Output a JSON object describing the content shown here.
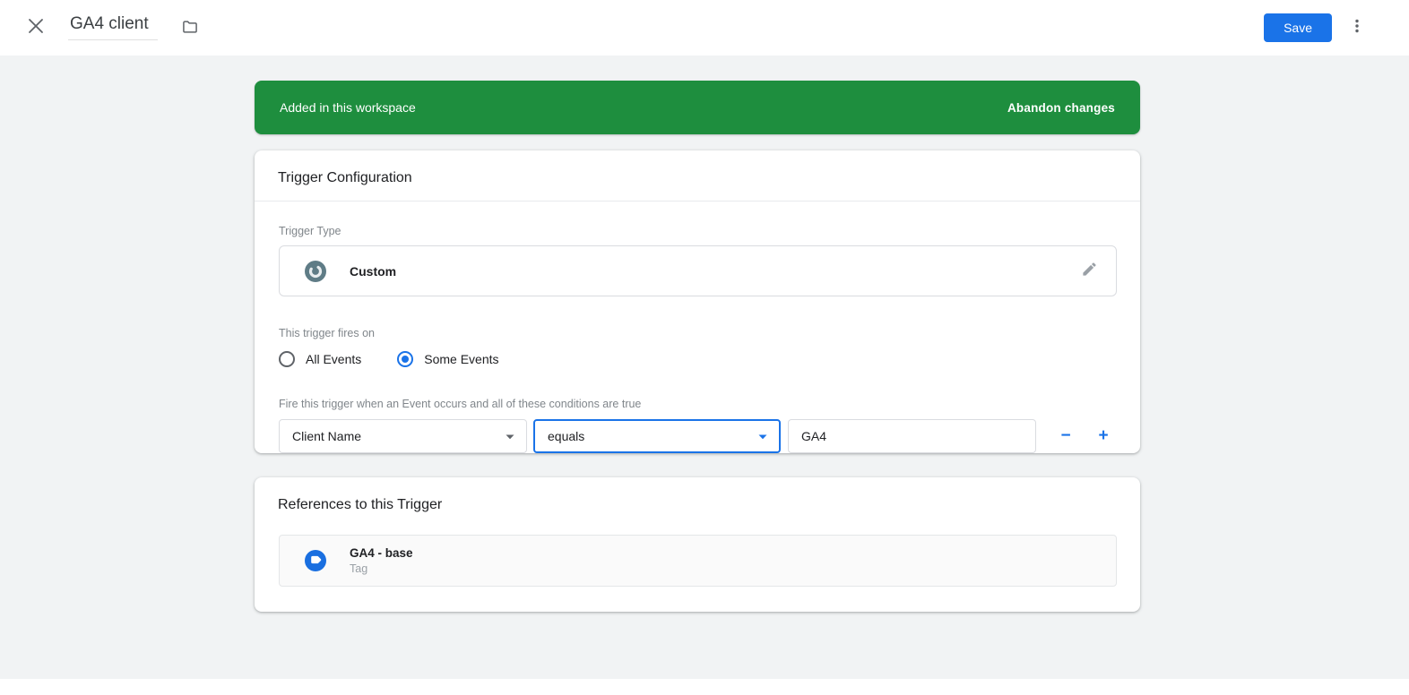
{
  "header": {
    "title": "GA4 client",
    "save_label": "Save"
  },
  "banner": {
    "message": "Added in this workspace",
    "action_label": "Abandon changes"
  },
  "trigger_card": {
    "title": "Trigger Configuration",
    "trigger_type_label": "Trigger Type",
    "trigger_type_value": "Custom",
    "fires_on_label": "This trigger fires on",
    "fire_options": [
      {
        "label": "All Events",
        "selected": false
      },
      {
        "label": "Some Events",
        "selected": true
      }
    ],
    "conditions_label": "Fire this trigger when an Event occurs and all of these conditions are true",
    "condition": {
      "variable": "Client Name",
      "operator": "equals",
      "value": "GA4"
    }
  },
  "references_card": {
    "title": "References to this Trigger",
    "items": [
      {
        "name": "GA4 - base",
        "type": "Tag"
      }
    ]
  },
  "colors": {
    "accent_blue": "#1a73e8",
    "banner_green": "#1e8e3e",
    "workspace_gray": "#f1f3f4",
    "tag_icon_blue": "#1a6fe0",
    "trigger_icon_slate": "#5f7c86"
  }
}
